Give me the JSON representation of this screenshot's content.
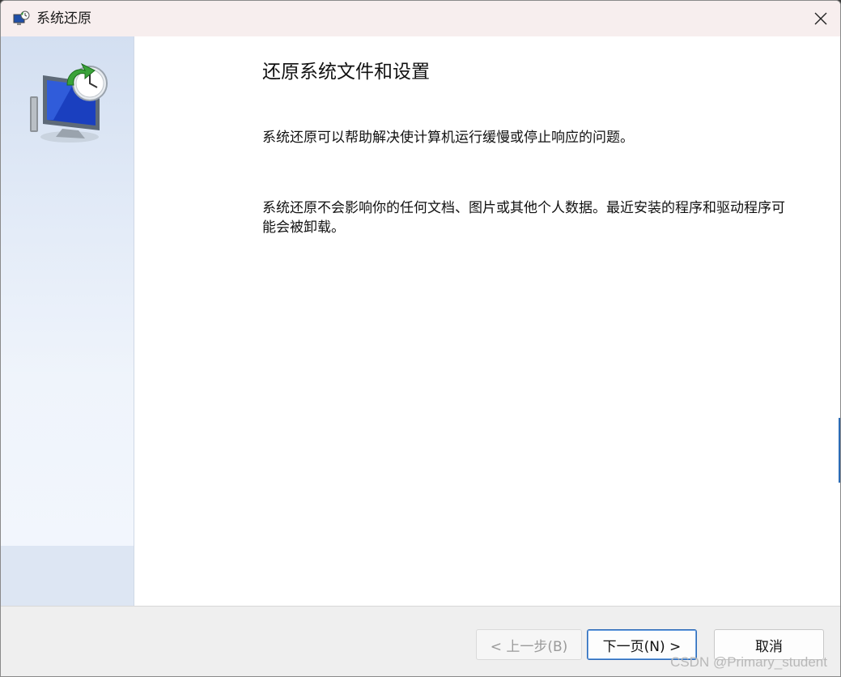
{
  "window": {
    "title": "系统还原"
  },
  "content": {
    "heading": "还原系统文件和设置",
    "paragraph1": "系统还原可以帮助解决使计算机运行缓慢或停止响应的问题。",
    "paragraph2": "系统还原不会影响你的任何文档、图片或其他个人数据。最近安装的程序和驱动程序可能会被卸载。"
  },
  "buttons": {
    "back": "< 上一步(B)",
    "next": "下一页(N) >",
    "cancel": "取消"
  },
  "watermark": "CSDN @Primary_student",
  "colors": {
    "accent": "#2d6ab8",
    "title_bar": "#f7eeee",
    "sidebar": "#e4ecf8"
  },
  "icons": {
    "app": "system-restore-icon",
    "close": "close-icon",
    "sidebar": "system-restore-monitor-clock-icon"
  }
}
